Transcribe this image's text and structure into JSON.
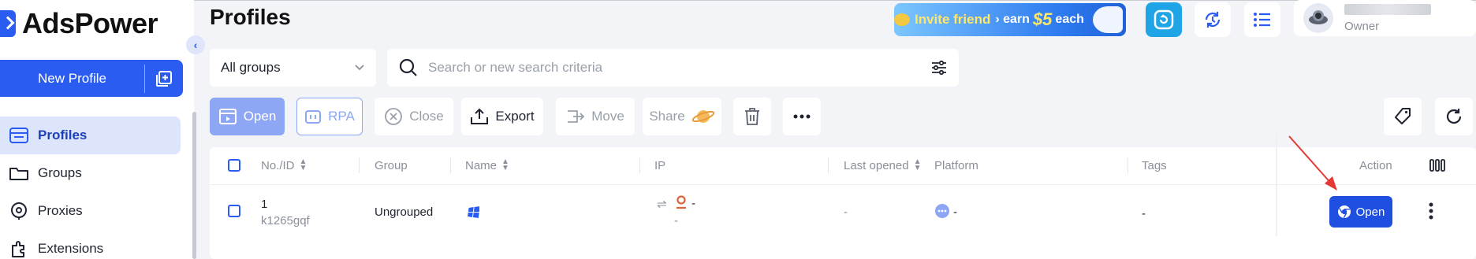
{
  "app": {
    "name": "AdsPower"
  },
  "sidebar": {
    "new_profile_label": "New Profile",
    "items": [
      {
        "label": "Profiles",
        "icon": "profiles-icon",
        "active": true
      },
      {
        "label": "Groups",
        "icon": "groups-icon",
        "active": false
      },
      {
        "label": "Proxies",
        "icon": "proxies-icon",
        "active": false
      },
      {
        "label": "Extensions",
        "icon": "extensions-icon",
        "active": false
      }
    ]
  },
  "header": {
    "title": "Profiles",
    "invite_banner": {
      "text1": "Invite friend",
      "text2": "› earn",
      "amount": "$5",
      "text3": "each"
    },
    "user": {
      "role": "Owner"
    }
  },
  "filters": {
    "group_select": "All groups",
    "search_placeholder": "Search or new search criteria"
  },
  "toolbar": {
    "open": "Open",
    "rpa": "RPA",
    "close": "Close",
    "export": "Export",
    "move": "Move",
    "share": "Share"
  },
  "table": {
    "columns": {
      "no_id": "No./ID",
      "group": "Group",
      "name": "Name",
      "ip": "IP",
      "last_opened": "Last opened",
      "platform": "Platform",
      "tags": "Tags",
      "action": "Action"
    },
    "rows": [
      {
        "no": "1",
        "id": "k1265gqf",
        "group": "Ungrouped",
        "ip": "-",
        "ip_sub": "-",
        "last_opened": "-",
        "platform": "-",
        "tags": "-",
        "action_label": "Open"
      }
    ]
  },
  "colors": {
    "accent": "#2b5cf2",
    "open_button": "#1f4fe0",
    "annotation_arrow": "#e53935"
  }
}
